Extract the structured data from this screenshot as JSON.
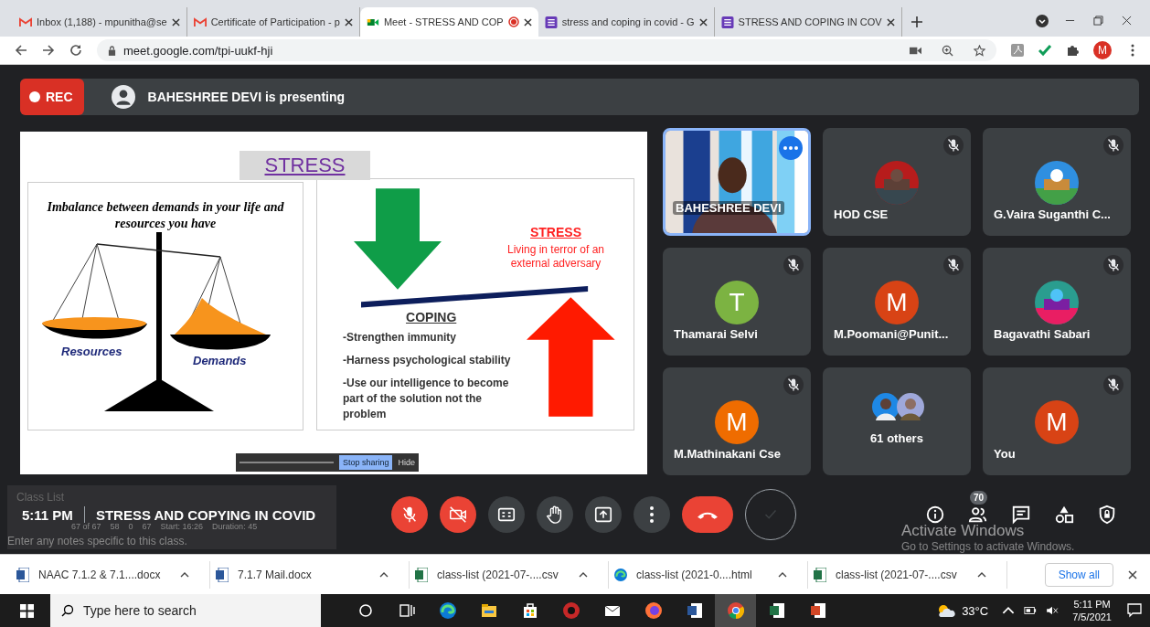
{
  "browser": {
    "tabs": [
      {
        "label": "Inbox (1,188) - mpunitha@se",
        "kind": "gmail",
        "selected": false,
        "recording": false
      },
      {
        "label": "Certificate of Participation - p",
        "kind": "gmail",
        "selected": false,
        "recording": false
      },
      {
        "label": "Meet - STRESS AND COP",
        "kind": "meet",
        "selected": true,
        "recording": true
      },
      {
        "label": "stress and coping in covid - G",
        "kind": "forms",
        "selected": false,
        "recording": false
      },
      {
        "label": "STRESS AND COPING IN COV",
        "kind": "forms",
        "selected": false,
        "recording": false
      }
    ],
    "address": "meet.google.com/tpi-uukf-hji",
    "profile": "M"
  },
  "meeting": {
    "rec": "REC",
    "presenting": "BAHESHREE DEVI is presenting",
    "time": "5:11 PM",
    "title": "STRESS AND COPYING IN COVID",
    "participant_count": "70"
  },
  "slide": {
    "title": "STRESS",
    "left_heading": "Imbalance between demands in your life and resources you have",
    "left_pan": "Resources",
    "right_pan": "Demands",
    "stress_heading": "STRESS",
    "stress_text": "Living in terror of an external adversary",
    "coping_heading": "COPING",
    "bullets": [
      "-Strengthen immunity",
      "-Harness psychological stability",
      "-Use our intelligence to become part of the solution not the problem"
    ],
    "share_bar": {
      "stop": "Stop sharing",
      "hide": "Hide"
    }
  },
  "tiles": [
    {
      "name": "BAHESHREE DEVI",
      "kind": "video",
      "muted": false,
      "selected": true
    },
    {
      "name": "HOD CSE",
      "muted": true,
      "selected": false
    },
    {
      "name": "G.Vaira Suganthi C...",
      "muted": true,
      "selected": false
    },
    {
      "name": "Thamarai Selvi",
      "kind": "letter",
      "letter": "T",
      "color": "#7cb342",
      "muted": true,
      "selected": false
    },
    {
      "name": "M.Poomani@Punit...",
      "kind": "letter",
      "letter": "M",
      "color": "#d84315",
      "muted": true,
      "selected": false
    },
    {
      "name": "Bagavathi Sabari",
      "muted": true,
      "selected": false
    },
    {
      "name": "M.Mathinakani Cse",
      "kind": "letter",
      "letter": "M",
      "color": "#ef6c00",
      "muted": true,
      "selected": false
    },
    {
      "name": "61 others",
      "kind": "others",
      "muted": false,
      "selected": false
    },
    {
      "name": "You",
      "kind": "letter",
      "letter": "M",
      "color": "#d84315",
      "muted": true,
      "selected": false
    }
  ],
  "controls": [
    {
      "kind": "mic",
      "off": true
    },
    {
      "kind": "camera",
      "off": true
    },
    {
      "kind": "captions",
      "off": false
    },
    {
      "kind": "hand",
      "off": false
    },
    {
      "kind": "present",
      "off": false
    },
    {
      "kind": "more",
      "off": false
    },
    {
      "kind": "end",
      "off": true
    },
    {
      "kind": "check",
      "off": false
    }
  ],
  "class_list_overlay": {
    "title": "Class List",
    "stats": [
      "67 of 67",
      "58",
      "0",
      "67",
      "Start: 16:26",
      "Duration: 45"
    ],
    "notes_placeholder": "Enter any notes specific to this class."
  },
  "activation": {
    "title": "Activate Windows",
    "text": "Go to Settings to activate Windows."
  },
  "downloads": {
    "items": [
      {
        "name": "NAAC 7.1.2 & 7.1....docx",
        "kind": "word"
      },
      {
        "name": "7.1.7 Mail.docx",
        "kind": "word"
      },
      {
        "name": "class-list (2021-07-....csv",
        "kind": "excel"
      },
      {
        "name": "class-list (2021-0....html",
        "kind": "edge"
      },
      {
        "name": "class-list (2021-07-....csv",
        "kind": "excel"
      }
    ],
    "show_all": "Show all"
  },
  "taskbar": {
    "search_placeholder": "Type here to search",
    "apps": [
      {
        "kind": "cortana",
        "selected": false
      },
      {
        "kind": "taskview",
        "selected": false
      },
      {
        "kind": "edge",
        "selected": false
      },
      {
        "kind": "explorer",
        "selected": false
      },
      {
        "kind": "store",
        "selected": false
      },
      {
        "kind": "red",
        "selected": false
      },
      {
        "kind": "mail",
        "selected": false
      },
      {
        "kind": "firefox",
        "selected": false
      },
      {
        "kind": "word",
        "selected": false
      },
      {
        "kind": "chrome",
        "selected": true
      },
      {
        "kind": "excel",
        "selected": false
      },
      {
        "kind": "powerpoint",
        "selected": false
      }
    ],
    "temperature": "33°C",
    "time": "5:11 PM",
    "date": "7/5/2021"
  }
}
